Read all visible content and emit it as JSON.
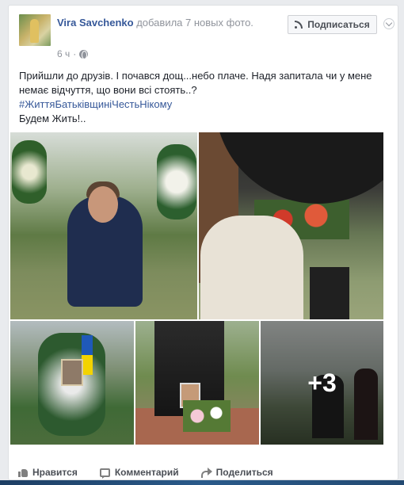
{
  "post": {
    "author": "Vira Savchenko",
    "action": "добавила 7 новых фото.",
    "time": "6 ч",
    "follow_label": "Подписаться",
    "text_lines": [
      "Прийшли до друзів. І почався дощ...небо плаче. Надя запитала чи у мене немає відчуття, що вони всі стоять..?",
      "#ЖиттяБатьківщиніЧестьНікому",
      "Будем Жить!.."
    ],
    "more_photos": "+3"
  },
  "actions": {
    "like": "Нравится",
    "comment": "Комментарий",
    "share": "Поделиться"
  },
  "icons": [
    "chevron-down-icon",
    "rss-icon",
    "globe-icon",
    "like-icon",
    "comment-icon",
    "share-icon"
  ],
  "colors": {
    "link": "#365899",
    "background": "#e9ebee"
  }
}
